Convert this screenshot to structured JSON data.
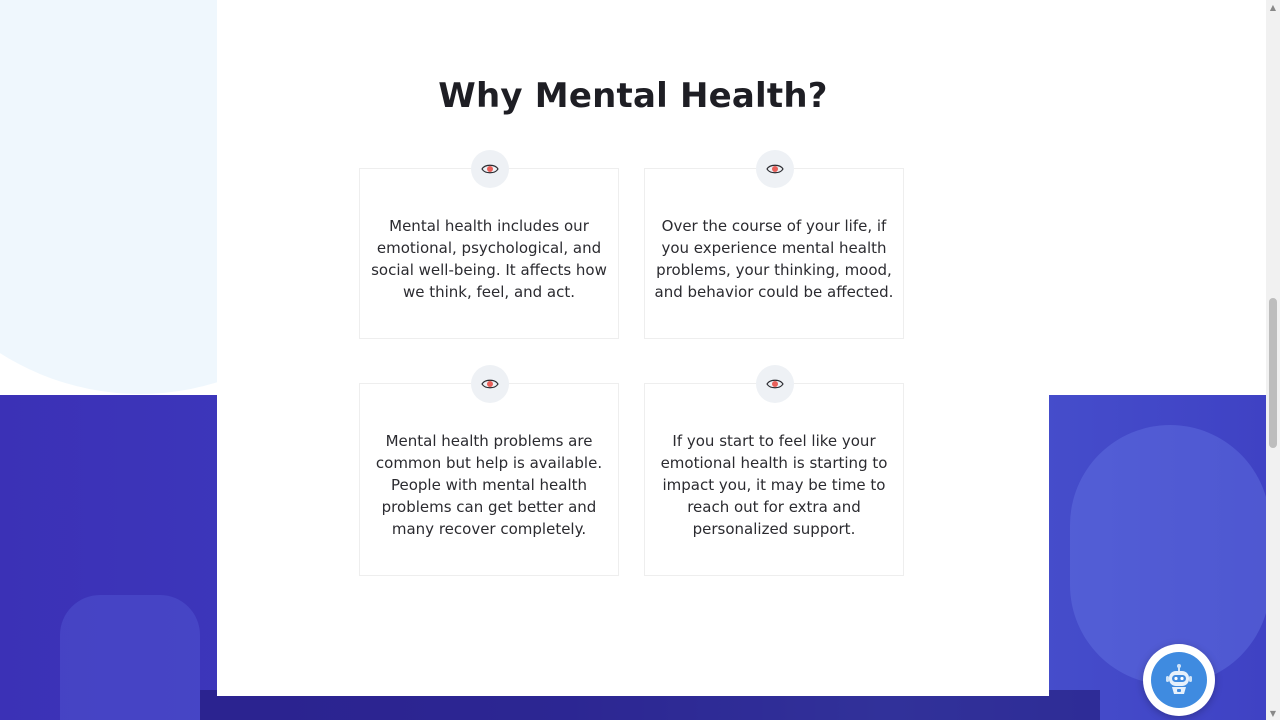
{
  "section": {
    "title": "Why Mental Health?"
  },
  "cards": [
    {
      "icon": "eye-icon",
      "text": "Mental health includes our emotional, psychological, and social well-being. It affects how we think, feel, and act."
    },
    {
      "icon": "eye-icon",
      "text": "Over the course of your life, if you experience mental health problems, your thinking, mood, and behavior could be affected."
    },
    {
      "icon": "eye-icon",
      "text": "Mental health problems are common but help is available. People with mental health problems can get better and many recover completely."
    },
    {
      "icon": "eye-icon",
      "text": "If you start to feel like your emotional health is starting to impact you, it may be time to reach out for extra and personalized support."
    }
  ],
  "chatbot": {
    "icon": "robot-icon"
  },
  "colors": {
    "accent_blue": "#3b31b6",
    "icon_accent": "#e8605a",
    "chatbot_blue": "#3f8be0",
    "light_bg": "#eff7fd"
  }
}
